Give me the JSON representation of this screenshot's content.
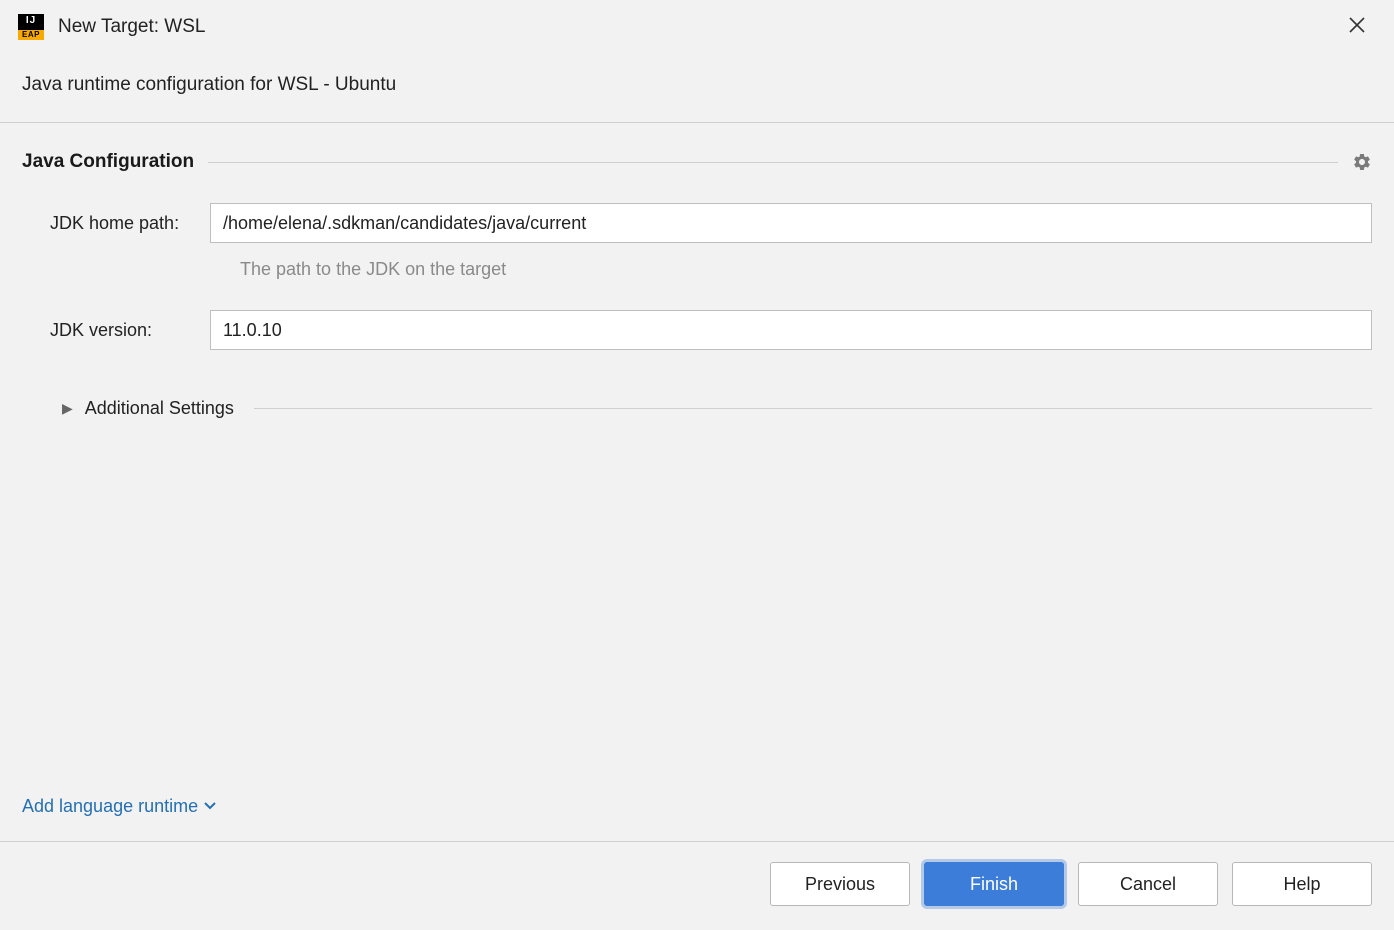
{
  "window": {
    "title": "New Target: WSL"
  },
  "subtitle": "Java runtime configuration for WSL - Ubuntu",
  "section": {
    "title": "Java Configuration"
  },
  "form": {
    "jdk_home": {
      "label": "JDK home path:",
      "value": "/home/elena/.sdkman/candidates/java/current",
      "hint": "The path to the JDK on the target"
    },
    "jdk_version": {
      "label": "JDK version:",
      "value": "11.0.10"
    }
  },
  "expandable": {
    "title": "Additional Settings"
  },
  "add_link": "Add language runtime",
  "buttons": {
    "previous": "Previous",
    "finish": "Finish",
    "cancel": "Cancel",
    "help": "Help"
  }
}
